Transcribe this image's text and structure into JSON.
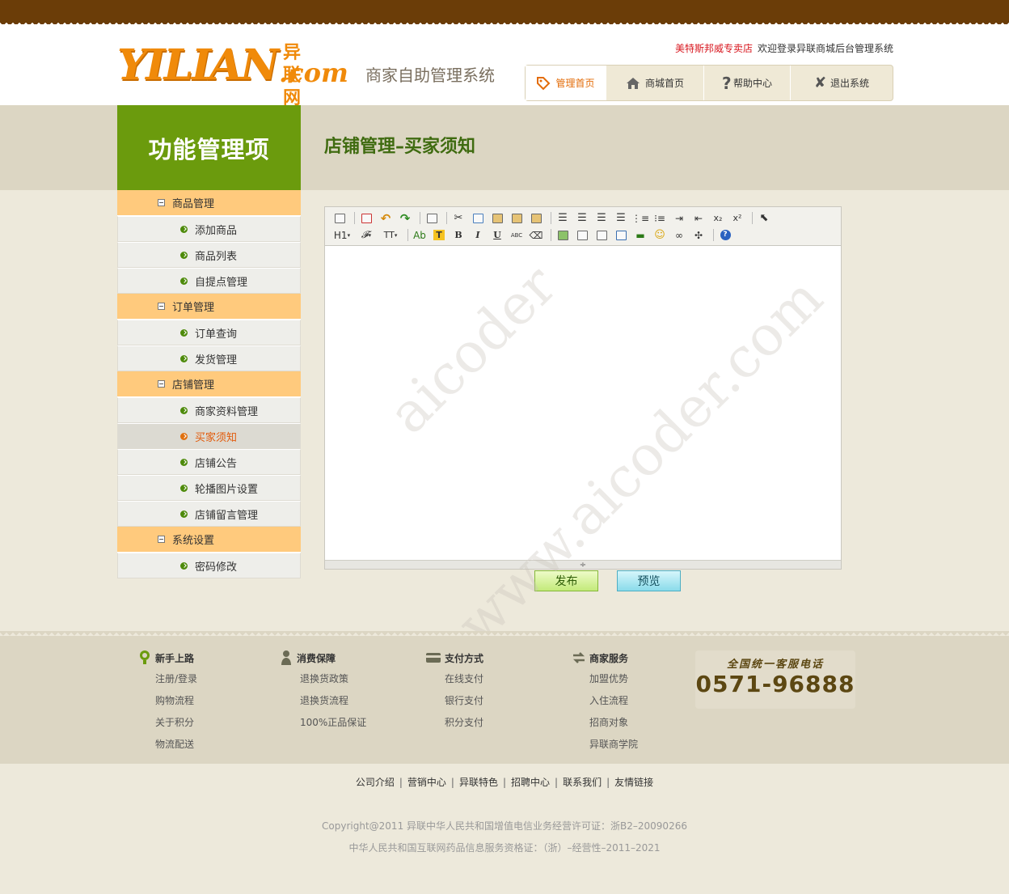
{
  "header": {
    "logo_main": "YILIAN",
    "logo_cn": "异联网",
    "logo_com": ".com",
    "system_name": "商家自助管理系统",
    "shop_name": "美特斯邦威专卖店",
    "welcome_text": "欢迎登录异联商城后台管理系统",
    "nav": [
      {
        "label": "管理首页",
        "icon": "tag-icon",
        "active": true
      },
      {
        "label": "商城首页",
        "icon": "home-icon",
        "active": false
      },
      {
        "label": "帮助中心",
        "icon": "question-icon",
        "active": false
      },
      {
        "label": "退出系统",
        "icon": "close-icon",
        "active": false
      }
    ]
  },
  "title_band": {
    "func_title": "功能管理项",
    "page_heading": "店铺管理–买家须知"
  },
  "sidebar": {
    "groups": [
      {
        "label": "商品管理",
        "items": [
          "添加商品",
          "商品列表",
          "自提点管理"
        ]
      },
      {
        "label": "订单管理",
        "items": [
          "订单查询",
          "发货管理"
        ]
      },
      {
        "label": "店铺管理",
        "items": [
          "商家资料管理",
          "买家须知",
          "店铺公告",
          "轮播图片设置",
          "店铺留言管理"
        ]
      },
      {
        "label": "系统设置",
        "items": [
          "密码修改"
        ]
      }
    ],
    "active_item": "买家须知"
  },
  "editor": {
    "toolbar_text": {
      "heading": "H1",
      "font": "𝓕",
      "size": "TT",
      "ab": "Ab",
      "t": "T",
      "bold": "B",
      "italic": "I",
      "underline": "U",
      "strike": "ABC",
      "sub": "x₂",
      "sup": "x²"
    },
    "resize_glyph": "÷"
  },
  "buttons": {
    "publish": "发布",
    "preview": "预览"
  },
  "watermark": {
    "line1": "aicoder",
    "line2": "www.aicoder.com"
  },
  "footer": {
    "columns": [
      {
        "title": "新手上路",
        "icon": "lightbulb-icon",
        "links": [
          "注册/登录",
          "购物流程",
          "关于积分",
          "物流配送"
        ]
      },
      {
        "title": "消费保障",
        "icon": "shield-person-icon",
        "links": [
          "退换货政策",
          "退换货流程",
          "100%正品保证"
        ]
      },
      {
        "title": "支付方式",
        "icon": "card-icon",
        "links": [
          "在线支付",
          "银行支付",
          "积分支付"
        ]
      },
      {
        "title": "商家服务",
        "icon": "exchange-icon",
        "links": [
          "加盟优势",
          "入住流程",
          "招商对象",
          "异联商学院"
        ]
      }
    ],
    "hotline_label": "全国统一客服电话",
    "hotline_number": "0571-96888"
  },
  "bottom_links": [
    "公司介绍",
    "营销中心",
    "异联特色",
    "招聘中心",
    "联系我们",
    "友情链接"
  ],
  "copyright_1": "Copyright@2011 异联中华人民共和国增值电信业务经营许可证：浙B2–20090266",
  "copyright_2": "中华人民共和国互联网药品信息服务资格证：（浙）–经营性–2011–2021",
  "colors": {
    "brand_orange": "#f08a0a",
    "top_band": "#6b3d08",
    "func_green": "#6b9b0d",
    "heading_green": "#3f6b10",
    "menu_group": "#ffca7d",
    "active_item": "#e25a0a"
  }
}
